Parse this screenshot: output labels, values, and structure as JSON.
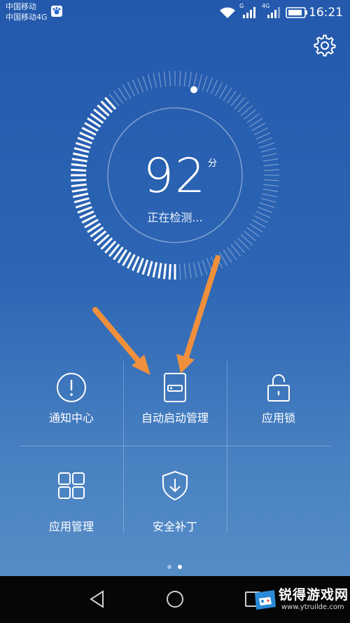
{
  "status_bar": {
    "carrier_1": "中国移动",
    "carrier_2": "中国移动4G",
    "signal_label_1": "G",
    "signal_label_2": "4G",
    "time": "16:21"
  },
  "gauge": {
    "score": "92",
    "unit": "分",
    "status": "正在检测...",
    "progress": 0.3
  },
  "grid": {
    "items": [
      {
        "label": "通知中心",
        "icon": "alert-circle-icon"
      },
      {
        "label": "自动启动管理",
        "icon": "phone-card-icon"
      },
      {
        "label": "应用锁",
        "icon": "unlocked-padlock-icon"
      },
      {
        "label": "应用管理",
        "icon": "four-squares-icon"
      },
      {
        "label": "安全补丁",
        "icon": "shield-download-icon"
      }
    ]
  },
  "page_indicator": {
    "pages": 2,
    "active": 2
  },
  "nav_bar": {
    "icons": [
      "back-icon",
      "home-icon",
      "recents-icon"
    ]
  },
  "watermark": {
    "title": "锐得游戏网",
    "url": "www.ytruilde.com"
  },
  "colors": {
    "background_top": "#2459ad",
    "background_bottom": "#5a91c9",
    "arrow": "#f0903c"
  }
}
